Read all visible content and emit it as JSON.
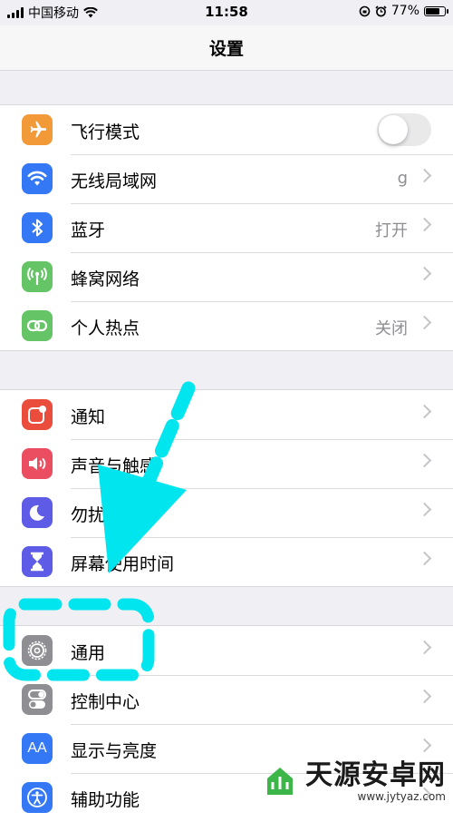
{
  "status_bar": {
    "carrier": "中国移动",
    "time": "11:58",
    "battery_percent": "77%",
    "battery_level": 0.77
  },
  "nav": {
    "title": "设置"
  },
  "group1": [
    {
      "label": "飞行模式",
      "icon": "airplane-icon",
      "color": "#f19a37",
      "control": "toggle",
      "toggle_on": false
    },
    {
      "label": "无线局域网",
      "icon": "wifi-icon",
      "color": "#3478f6",
      "value": "g",
      "control": "chevron"
    },
    {
      "label": "蓝牙",
      "icon": "bluetooth-icon",
      "color": "#3478f6",
      "value": "打开",
      "control": "chevron"
    },
    {
      "label": "蜂窝网络",
      "icon": "antenna-icon",
      "color": "#65c466",
      "control": "chevron"
    },
    {
      "label": "个人热点",
      "icon": "hotspot-icon",
      "color": "#65c466",
      "value": "关闭",
      "control": "chevron"
    }
  ],
  "group2": [
    {
      "label": "通知",
      "icon": "notification-icon",
      "color": "#eb4d3d",
      "control": "chevron"
    },
    {
      "label": "声音与触感",
      "icon": "speaker-icon",
      "color": "#eb4e61",
      "control": "chevron"
    },
    {
      "label": "勿扰模式",
      "icon": "moon-icon",
      "color": "#5e5ce6",
      "control": "chevron"
    },
    {
      "label": "屏幕使用时间",
      "icon": "hourglass-icon",
      "color": "#5e5ce6",
      "control": "chevron"
    }
  ],
  "group3": [
    {
      "label": "通用",
      "icon": "gear-icon",
      "color": "#8e8e93",
      "control": "chevron"
    },
    {
      "label": "控制中心",
      "icon": "switches-icon",
      "color": "#8e8e93",
      "control": "chevron"
    },
    {
      "label": "显示与亮度",
      "icon": "text-size-icon",
      "color": "#3478f6",
      "control": "chevron"
    },
    {
      "label": "辅助功能",
      "icon": "accessibility-icon",
      "color": "#3478f6",
      "control": "chevron"
    }
  ],
  "icon_text": {
    "text_size": "AA"
  },
  "annotation": {
    "color": "#00e5ee"
  },
  "watermark": {
    "title": "天源安卓网",
    "url": "www.jytyaz.com"
  }
}
